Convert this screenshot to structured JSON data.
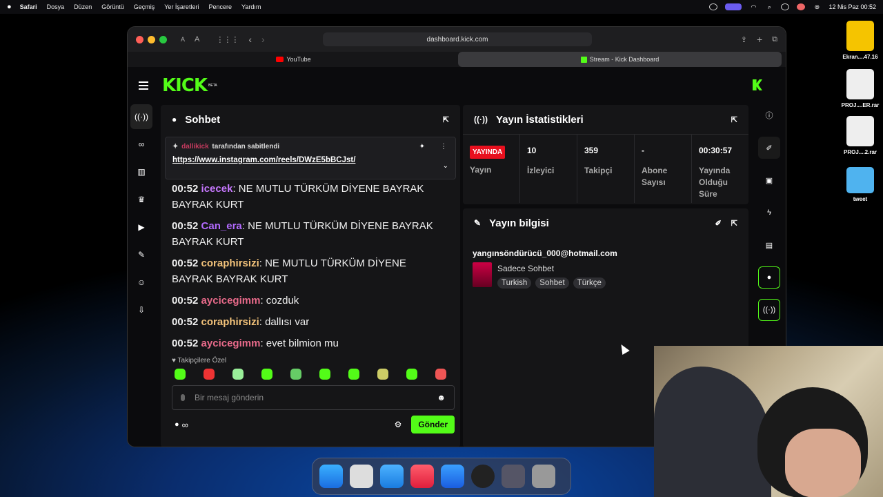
{
  "menubar": {
    "app": "Safari",
    "items": [
      "Dosya",
      "Düzen",
      "Görüntü",
      "Geçmiş",
      "Yer İşaretleri",
      "Pencere",
      "Yardım"
    ],
    "clock": "12 Nis Paz  00:52"
  },
  "desktop": [
    {
      "label": "Ekran....47.16"
    },
    {
      "label": "PROJ....ER.rar"
    },
    {
      "label": "PROJ....2.rar"
    },
    {
      "label": "tweet"
    }
  ],
  "browser": {
    "url": "dashboard.kick.com",
    "tabs": [
      {
        "label": "YouTube"
      },
      {
        "label": "Stream - Kick Dashboard"
      }
    ],
    "text_btn_small": "A",
    "text_btn_large": "A"
  },
  "kick": {
    "logo": "KICK",
    "beta": "BETA"
  },
  "chat": {
    "title": "Sohbet",
    "pinned_user": "dallikick",
    "pinned_suffix": "tarafından sabitlendi",
    "pinned_link": "https://www.instagram.com/reels/DWzE5bBCJst/",
    "messages": [
      {
        "time": "00:52",
        "user": "icecek",
        "color": "#c778ff",
        "text": ": NE MUTLU TÜRKÜM DİYENE BAYRAK BAYRAK KURT"
      },
      {
        "time": "00:52",
        "user": "Can_era",
        "color": "#b36bff",
        "text": ": NE MUTLU TÜRKÜM DİYENE BAYRAK BAYRAK KURT"
      },
      {
        "time": "00:52",
        "user": "coraphirsizi",
        "color": "#f2c27a",
        "text": ": NE MUTLU TÜRKÜM DİYENE BAYRAK BAYRAK KURT"
      },
      {
        "time": "00:52",
        "user": "aycicegimm",
        "color": "#e86a8a",
        "text": ": cozduk"
      },
      {
        "time": "00:52",
        "user": "coraphirsizi",
        "color": "#f2c27a",
        "text": ": dallısı var"
      },
      {
        "time": "00:52",
        "user": "aycicegimm",
        "color": "#e86a8a",
        "text": ": evet bilmion mu"
      }
    ],
    "followers_only": "Takipçilere Özel",
    "input_placeholder": "Bir mesaj gönderin",
    "infinity": "∞",
    "send": "Gönder"
  },
  "stats": {
    "title": "Yayın İstatistikleri",
    "live_badge": "YAYINDA",
    "live_label": "Yayın",
    "cells": [
      {
        "value": "10",
        "label": "İzleyici"
      },
      {
        "value": "359",
        "label": "Takipçi"
      },
      {
        "value": "-",
        "label": "Abone Sayısı"
      },
      {
        "value": "00:30:57",
        "label": "Yayında Olduğu Süre"
      }
    ]
  },
  "info": {
    "title": "Yayın bilgisi",
    "email": "yangınsöndürücü_000@hotmail.com",
    "stream_title": "Sadece Sohbet",
    "tags": [
      "Turkish",
      "Sohbet",
      "Türkçe"
    ]
  },
  "colors": {
    "accent": "#53fc18",
    "live": "#e8101e"
  }
}
